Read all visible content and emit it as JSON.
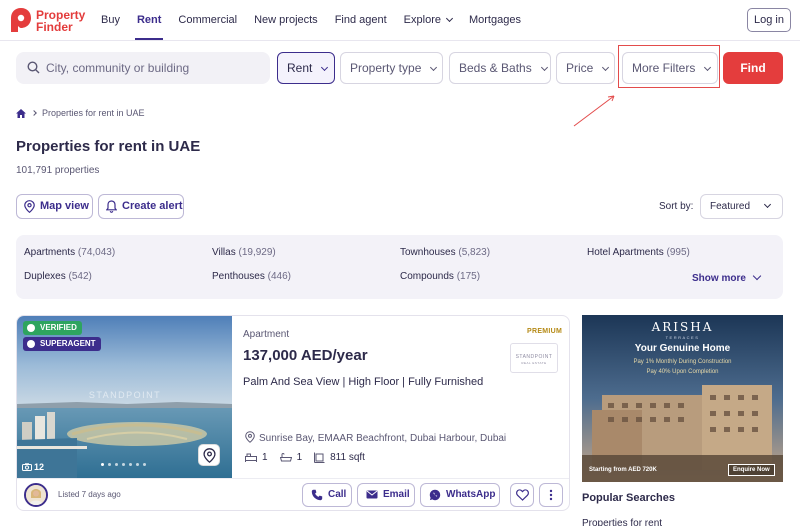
{
  "header": {
    "logo_line1": "Property",
    "logo_line2": "Finder",
    "nav": [
      {
        "label": "Buy"
      },
      {
        "label": "Rent"
      },
      {
        "label": "Commercial"
      },
      {
        "label": "New projects"
      },
      {
        "label": "Find agent"
      },
      {
        "label": "Explore"
      },
      {
        "label": "Mortgages"
      }
    ],
    "login_label": "Log in"
  },
  "search": {
    "placeholder": "City, community or building",
    "filters": [
      {
        "label": "Rent",
        "selected": true
      },
      {
        "label": "Property type"
      },
      {
        "label": "Beds & Baths"
      },
      {
        "label": "Price"
      },
      {
        "label": "More Filters"
      }
    ],
    "find_label": "Find"
  },
  "breadcrumb": {
    "current": "Properties for rent in UAE"
  },
  "page": {
    "title": "Properties for rent in UAE",
    "count": "101,791 properties",
    "map_view": "Map view",
    "create_alert": "Create alert",
    "sort_label": "Sort by:",
    "sort_value": "Featured"
  },
  "categories": [
    {
      "name": "Apartments",
      "count": "(74,043)"
    },
    {
      "name": "Villas",
      "count": "(19,929)"
    },
    {
      "name": "Townhouses",
      "count": "(5,823)"
    },
    {
      "name": "Hotel Apartments",
      "count": "(995)"
    },
    {
      "name": "Duplexes",
      "count": "(542)"
    },
    {
      "name": "Penthouses",
      "count": "(446)"
    },
    {
      "name": "Compounds",
      "count": "(175)"
    }
  ],
  "show_more": "Show more",
  "listing": {
    "verified": "VERIFIED",
    "superagent": "SUPERAGENT",
    "photo_count": "12",
    "photo_watermark": "STANDPOINT",
    "type": "Apartment",
    "premium": "PREMIUM",
    "price": "137,000 AED/year",
    "agency": "STANDPOINT",
    "agency_sub": "REAL ESTATE",
    "title": "Palm And Sea View | High Floor | Fully Furnished",
    "location": "Sunrise Bay, EMAAR Beachfront, Dubai Harbour, Dubai",
    "beds": "1",
    "baths": "1",
    "area": "811 sqft",
    "listed": "Listed 7 days ago",
    "call": "Call",
    "email": "Email",
    "whatsapp": "WhatsApp"
  },
  "ad": {
    "brand": "ARISHA",
    "brand_sub": "TERRACES",
    "headline": "Your Genuine Home",
    "line1": "Pay 1% Monthly During Construction",
    "line2": "Pay 40% Upon Completion",
    "starting": "Starting from AED 720K",
    "enquire": "Enquire Now"
  },
  "popular": {
    "title": "Popular Searches",
    "first_item": "Properties for rent"
  },
  "colors": {
    "brand_red": "#e43d3d",
    "brand_purple": "#3c2d8c",
    "verified_green": "#2ea45f"
  }
}
